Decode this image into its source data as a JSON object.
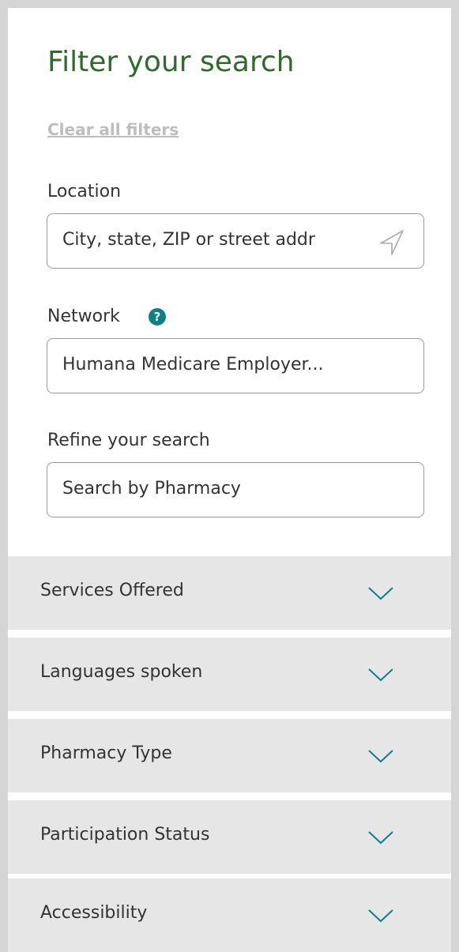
{
  "filter": {
    "title": "Filter your search",
    "clear_all": "Clear all filters"
  },
  "location": {
    "label": "Location",
    "placeholder": "City, state, ZIP or street addr",
    "icon": "location-arrow-icon"
  },
  "network": {
    "label": "Network",
    "help_glyph": "?",
    "value": "Humana Medicare Employer..."
  },
  "refine": {
    "label": "Refine your search",
    "placeholder": "Search by Pharmacy"
  },
  "accordions": [
    {
      "label": "Services Offered"
    },
    {
      "label": "Languages spoken"
    },
    {
      "label": "Pharmacy Type"
    },
    {
      "label": "Participation Status"
    },
    {
      "label": "Accessibility"
    }
  ],
  "colors": {
    "title": "#2f6b2a",
    "accent": "#0e7f87",
    "accordion_bg": "#e6e6e6",
    "border": "#d5d5d5"
  }
}
